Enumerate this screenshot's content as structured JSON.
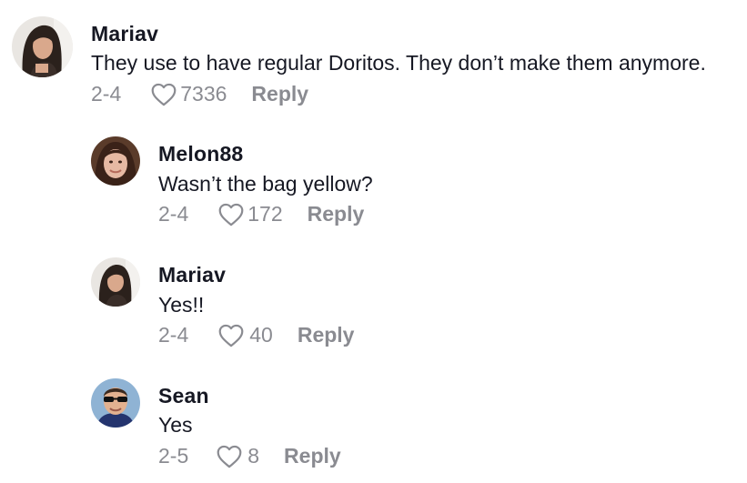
{
  "comments": [
    {
      "username": "Mariav",
      "text": "They use to have regular Doritos. They don’t make them anymore.",
      "date": "2-4",
      "likes": "7336",
      "reply_label": "Reply",
      "avatar": "woman-long-dark-hair-avatar"
    },
    {
      "username": "Melon88",
      "text": "Wasn’t the bag yellow?",
      "date": "2-4",
      "likes": "172",
      "reply_label": "Reply",
      "avatar": "woman-short-hair-avatar"
    },
    {
      "username": "Mariav",
      "text": "Yes!!",
      "date": "2-4",
      "likes": "40",
      "reply_label": "Reply",
      "avatar": "woman-long-dark-hair-avatar"
    },
    {
      "username": "Sean",
      "text": "Yes",
      "date": "2-5",
      "likes": "8",
      "reply_label": "Reply",
      "avatar": "man-sunglasses-avatar"
    }
  ],
  "icons": {
    "like": "heart-outline-icon"
  },
  "colors": {
    "username": "#161823",
    "body_text": "#161823",
    "meta_text": "#8a8b91"
  }
}
